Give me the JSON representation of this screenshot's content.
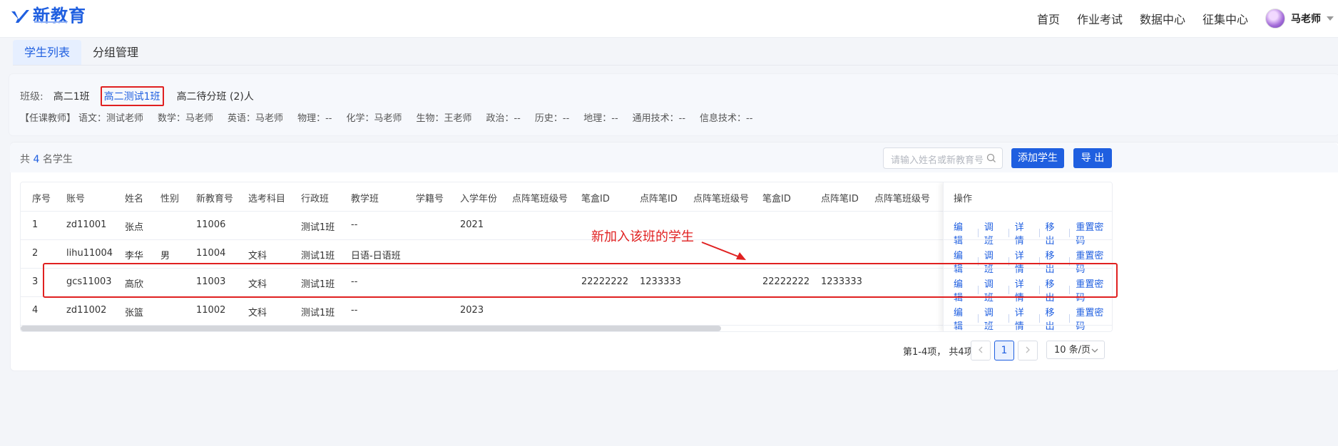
{
  "header": {
    "logo_text": "新教育",
    "nav": [
      "首页",
      "作业考试",
      "数据中心",
      "征集中心"
    ],
    "user_name": "马老师"
  },
  "tabs": [
    {
      "label": "学生列表",
      "active": true
    },
    {
      "label": "分组管理",
      "active": false
    }
  ],
  "class_filter": {
    "label": "班级:",
    "classes": [
      "高二1班",
      "高二测试1班",
      "高二待分班 (2)人"
    ],
    "selected": "高二测试1班"
  },
  "teachers": {
    "label": "【任课教师】",
    "items": [
      "语文：测试老师",
      "数学：马老师",
      "英语：马老师",
      "物理：--",
      "化学：马老师",
      "生物：王老师",
      "政治：--",
      "历史：--",
      "地理：--",
      "通用技术：--",
      "信息技术：--"
    ]
  },
  "list": {
    "total_prefix": "共",
    "total_count": "4",
    "total_suffix": "名学生",
    "search_placeholder": "请输入姓名或新教育号",
    "add_label": "添加学生",
    "export_label": "导 出"
  },
  "table": {
    "columns": [
      "序号",
      "账号",
      "姓名",
      "性别",
      "新教育号",
      "选考科目",
      "行政班",
      "教学班",
      "学籍号",
      "入学年份",
      "点阵笔班级号",
      "笔盒ID",
      "点阵笔ID",
      "点阵笔班级号",
      "笔盒ID",
      "点阵笔ID",
      "点阵笔班级号"
    ],
    "ops_header": "操作",
    "rows": [
      [
        "1",
        "zd11001",
        "张点",
        "",
        "11006",
        "",
        "测试1班",
        "--",
        "",
        "2021",
        "",
        "",
        "",
        "",
        "",
        "",
        ""
      ],
      [
        "2",
        "lihu11004",
        "李华",
        "男",
        "11004",
        "文科",
        "测试1班",
        "日语-日语班",
        "",
        "",
        "",
        "",
        "",
        "",
        "",
        "",
        ""
      ],
      [
        "3",
        "gcs11003",
        "高欣",
        "",
        "11003",
        "文科",
        "测试1班",
        "--",
        "",
        "",
        "",
        "22222222",
        "1233333",
        "",
        "22222222",
        "1233333",
        ""
      ],
      [
        "4",
        "zd11002",
        "张篮",
        "",
        "11002",
        "文科",
        "测试1班",
        "--",
        "",
        "2023",
        "",
        "",
        "",
        "",
        "",
        "",
        ""
      ]
    ],
    "ops": [
      "编辑",
      "调班",
      "详情",
      "移出",
      "重置密码"
    ]
  },
  "annotation": {
    "text": "新加入该班的学生",
    "color": "#e02020"
  },
  "pagination": {
    "info": "第1-4项，  共4项",
    "current_page": "1",
    "page_size": "10 条/页"
  },
  "colors": {
    "primary": "#1f5fe0",
    "highlight": "#e02020"
  }
}
